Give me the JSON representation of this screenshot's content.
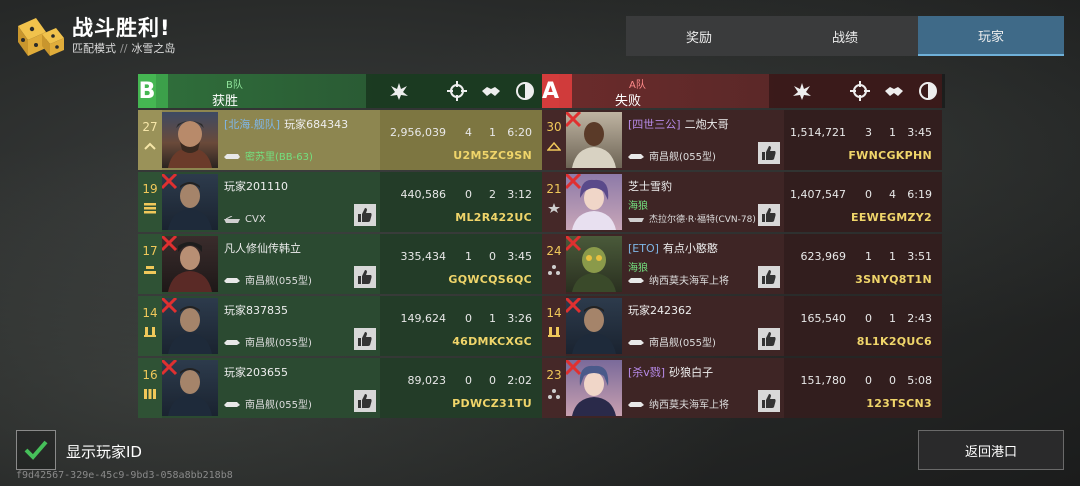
{
  "header": {
    "title": "战斗胜利!",
    "mode": "匹配模式",
    "separator": "//",
    "map": "冰雪之岛"
  },
  "tabs": [
    {
      "label": "奖励",
      "active": false
    },
    {
      "label": "战绩",
      "active": false
    },
    {
      "label": "玩家",
      "active": true
    }
  ],
  "teams": {
    "left": {
      "letter": "B",
      "name": "B队",
      "result": "获胜",
      "color": "#45b652"
    },
    "right": {
      "letter": "A",
      "name": "A队",
      "result": "失败",
      "color": "#d33c3c"
    }
  },
  "left_rows": [
    {
      "rank": "27",
      "clan": "[北海.舰队]",
      "name": "玩家684343",
      "ship": "密苏里(BB-63)",
      "score": "2,956,039",
      "a": "4",
      "b": "1",
      "time": "6:20",
      "code": "U2M5ZC9SN"
    },
    {
      "rank": "19",
      "clan": "",
      "name": "玩家201110",
      "ship": "CVX",
      "score": "440,586",
      "a": "0",
      "b": "2",
      "time": "3:12",
      "code": "ML2R422UC"
    },
    {
      "rank": "17",
      "clan": "",
      "name": "凡人修仙传韩立",
      "ship": "南昌舰(055型)",
      "score": "335,434",
      "a": "1",
      "b": "0",
      "time": "3:45",
      "code": "GQWCQS6QC"
    },
    {
      "rank": "14",
      "clan": "",
      "name": "玩家837835",
      "ship": "南昌舰(055型)",
      "score": "149,624",
      "a": "0",
      "b": "1",
      "time": "3:26",
      "code": "46DMKCXGC"
    },
    {
      "rank": "16",
      "clan": "",
      "name": "玩家203655",
      "ship": "南昌舰(055型)",
      "score": "89,023",
      "a": "0",
      "b": "0",
      "time": "2:02",
      "code": "PDWCZ31TU"
    }
  ],
  "right_rows": [
    {
      "rank": "30",
      "clan": "[四世三公]",
      "name": "二炮大哥",
      "pclass": "",
      "ship": "南昌舰(055型)",
      "score": "1,514,721",
      "a": "3",
      "b": "1",
      "time": "3:45",
      "code": "FWNCGKPHN"
    },
    {
      "rank": "21",
      "clan": "",
      "name": "芝士雪豹",
      "pclass": "海狼",
      "ship": "杰拉尔德·R·福特(CVN-78)",
      "score": "1,407,547",
      "a": "0",
      "b": "4",
      "time": "6:19",
      "code": "EEWEGMZY2"
    },
    {
      "rank": "24",
      "clan": "[ETO]",
      "name": "有点小憨憨",
      "pclass": "海狼",
      "ship": "纳西莫夫海军上将",
      "score": "623,969",
      "a": "1",
      "b": "1",
      "time": "3:51",
      "code": "3SNYQ8T1N"
    },
    {
      "rank": "14",
      "clan": "",
      "name": "玩家242362",
      "pclass": "",
      "ship": "南昌舰(055型)",
      "score": "165,540",
      "a": "0",
      "b": "1",
      "time": "2:43",
      "code": "8L1K2QUC6"
    },
    {
      "rank": "23",
      "clan": "[杀v戮]",
      "name": "砂狼白子",
      "pclass": "",
      "ship": "纳西莫夫海军上将",
      "score": "151,780",
      "a": "0",
      "b": "0",
      "time": "5:08",
      "code": "123TSCN3"
    }
  ],
  "footer": {
    "checkbox_label": "显示玩家ID",
    "checked": true,
    "uuid": "f9d42567-329e-45c9-9bd3-058a8bb218b8",
    "back_label": "返回港口"
  }
}
